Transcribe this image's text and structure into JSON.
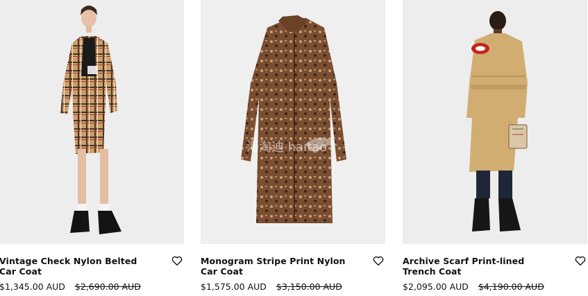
{
  "products": [
    {
      "title": "Vintage Check Nylon Belted Car Coat",
      "price": "$1,345.00 AUD",
      "original_price": "$2,690.00 AUD",
      "image_icon": "model-wearing-check-coat",
      "favorite_icon": "heart-icon"
    },
    {
      "title": "Monogram Stripe Print Nylon Car Coat",
      "price": "$1,575.00 AUD",
      "original_price": "$3,150.00 AUD",
      "image_icon": "monogram-coat-flat",
      "watermark": "海淘迪 haitao",
      "favorite_icon": "heart-icon"
    },
    {
      "title": "Archive Scarf Print-lined Trench Coat",
      "price": "$2,095.00 AUD",
      "original_price": "$4,190.00 AUD",
      "image_icon": "model-wearing-trench-back",
      "favorite_icon": "heart-icon"
    }
  ],
  "colors": {
    "image_bg": "#efefef",
    "text": "#111111"
  }
}
